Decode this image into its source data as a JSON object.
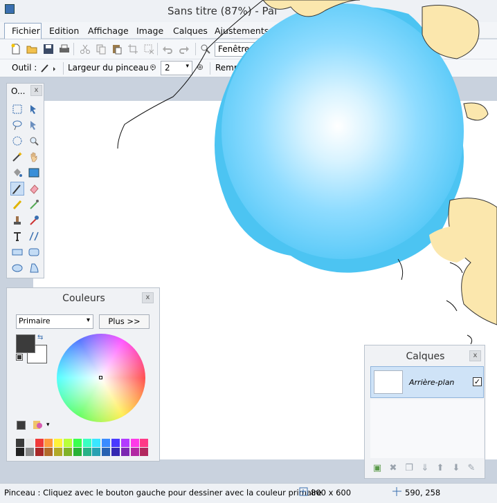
{
  "window": {
    "title": "Sans titre (87%) - Pai"
  },
  "menu": {
    "items": [
      "Fichier",
      "Edition",
      "Affichage",
      "Image",
      "Calques",
      "Ajustements"
    ]
  },
  "toolbar": {
    "window_select": "Fenêtre",
    "tool_label": "Outil :",
    "brush_width_label": "Largeur du pinceau :",
    "brush_width_value": "2",
    "fill_label": "Remp"
  },
  "tools_panel": {
    "title": "O...",
    "close": "x"
  },
  "colors_panel": {
    "title": "Couleurs",
    "close": "x",
    "mode_select": "Primaire",
    "more_button": "Plus >>",
    "primary_color": "#3b3b3b",
    "secondary_color": "#ffffff",
    "palette": [
      [
        "#3b3b3b",
        "#e9e9e9",
        "#f03a3a",
        "#ff9a3c",
        "#fff23a",
        "#b9ff3a",
        "#3aff4e",
        "#3affc2",
        "#3ae6ff",
        "#3a8cff",
        "#4a3aff",
        "#b23aff",
        "#ff3ae8",
        "#ff3a86"
      ],
      [
        "#222222",
        "#8a8a8a",
        "#a82828",
        "#b26a2a",
        "#b2a928",
        "#80b228",
        "#28b236",
        "#28b287",
        "#28a1b2",
        "#2862b2",
        "#3428b2",
        "#7c28b2",
        "#b228a3",
        "#b2285e"
      ]
    ]
  },
  "layers_panel": {
    "title": "Calques",
    "close": "x",
    "layers": [
      {
        "name": "Arrière-plan",
        "visible": true
      }
    ]
  },
  "status": {
    "text": "Pinceau : Cliquez avec le bouton gauche pour dessiner avec la couleur primaire",
    "size": "800 x 600",
    "coords": "590, 258"
  }
}
